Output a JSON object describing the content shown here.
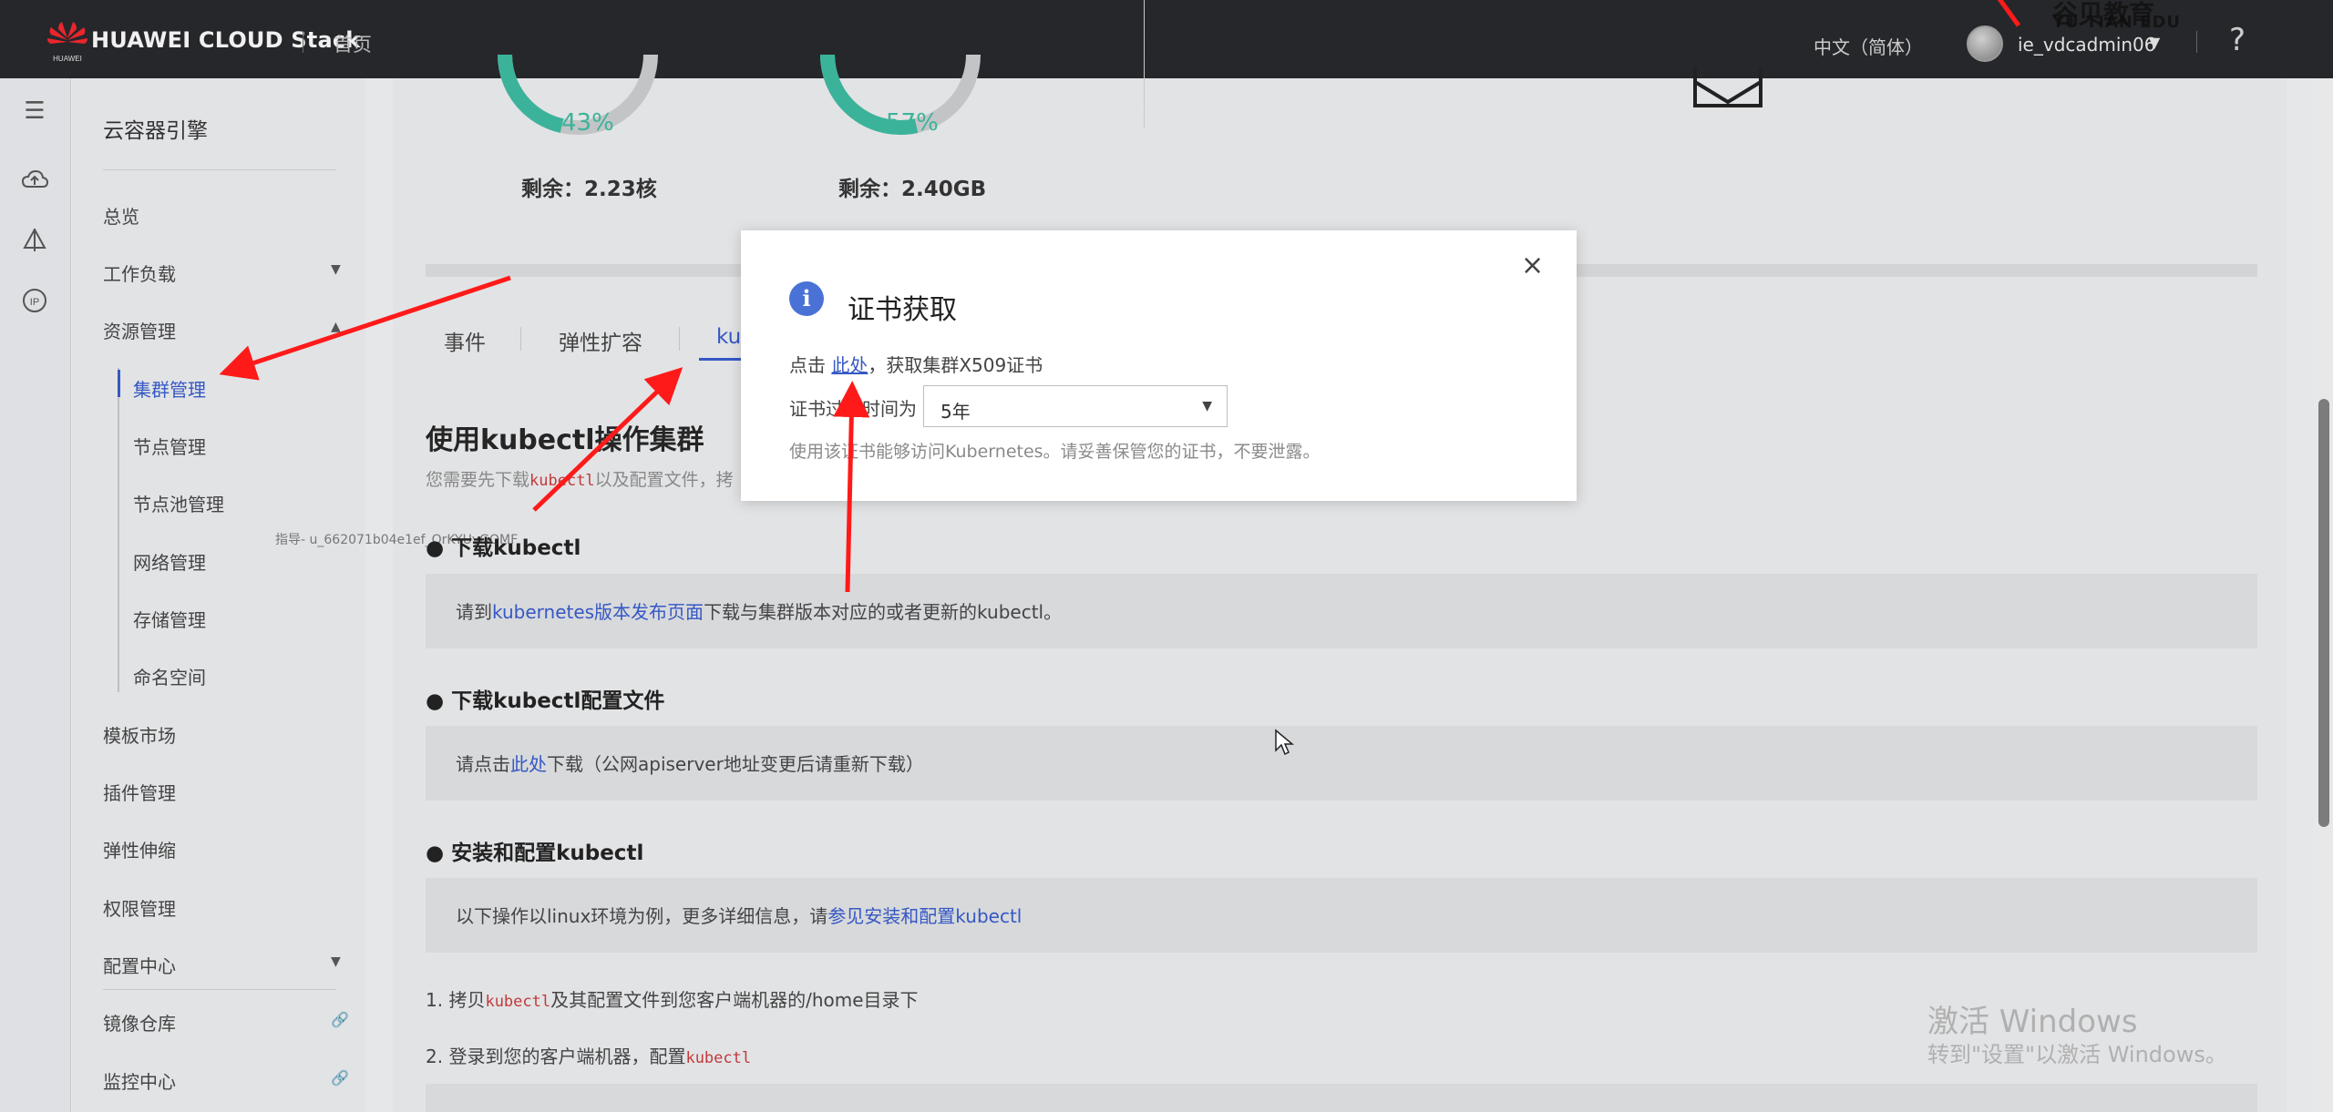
{
  "topbar": {
    "brand_sub": "HUAWEI",
    "brand": "HUAWEI CLOUD Stack",
    "home": "首页",
    "language": "中文（简体）",
    "username": "ie_vdcadmin06",
    "help": "?",
    "watermark_title": "谷贝教育",
    "watermark_sub": "YU TIAN EDU"
  },
  "sidebar": {
    "title": "云容器引擎",
    "items": [
      {
        "label": "总览"
      },
      {
        "label": "工作负载"
      },
      {
        "label": "资源管理"
      },
      {
        "label": "集群管理"
      },
      {
        "label": "节点管理"
      },
      {
        "label": "节点池管理"
      },
      {
        "label": "网络管理"
      },
      {
        "label": "存储管理"
      },
      {
        "label": "命名空间"
      },
      {
        "label": "模板市场"
      },
      {
        "label": "插件管理"
      },
      {
        "label": "弹性伸缩"
      },
      {
        "label": "权限管理"
      },
      {
        "label": "配置中心"
      },
      {
        "label": "镜像仓库"
      },
      {
        "label": "监控中心"
      }
    ]
  },
  "usage": {
    "cpu": {
      "percent": "43%",
      "remaining": "剩余：2.23核",
      "value": 0.43
    },
    "memory": {
      "percent": "57%",
      "remaining": "剩余：2.40GB",
      "value": 0.57
    }
  },
  "tabs": [
    "事件",
    "弹性扩容",
    "ku"
  ],
  "section": {
    "title": "使用kubectl操作集群",
    "desc_prefix": "您需要先下载",
    "desc_code": "kubectl",
    "desc_suffix": "以及配置文件，拷",
    "watermark": "指导- u_662071b04e1ef_OrKYUyGOMF",
    "blocks": [
      {
        "title": "● 下载kubectl",
        "text_prefix": "请到",
        "link": "kubernetes版本发布页面",
        "text_suffix": "下载与集群版本对应的或者更新的kubectl。"
      },
      {
        "title": "● 下载kubectl配置文件",
        "text_prefix": "请点击",
        "link": "此处",
        "text_suffix": "下载（公网apiserver地址变更后请重新下载）"
      },
      {
        "title": "● 安装和配置kubectl",
        "text_prefix": "以下操作以linux环境为例，更多详细信息，请",
        "link": "参见安装和配置kubectl",
        "text_suffix": ""
      }
    ],
    "steps": [
      {
        "prefix": "1. 拷贝",
        "code": "kubectl",
        "suffix": "及其配置文件到您客户端机器的/home目录下"
      },
      {
        "prefix": "2. 登录到您的客户端机器，配置",
        "code": "kubectl",
        "suffix": ""
      }
    ]
  },
  "dialog": {
    "icon": "i",
    "title": "证书获取",
    "close": "×",
    "line_prefix": "点击",
    "line_link": "此处",
    "line_suffix": "，获取集群X509证书",
    "expire_label": "证书过期时间为",
    "expire_value": "5年",
    "note": "使用该证书能够访问Kubernetes。请妥善保管您的证书，不要泄露。"
  },
  "windows_watermark": {
    "line1": "激活 Windows",
    "line2": "转到\"设置\"以激活 Windows。"
  },
  "colors": {
    "accent": "#3558c4",
    "gauge": "#3bb39a",
    "annotation_arrow": "#ff1a1a"
  }
}
